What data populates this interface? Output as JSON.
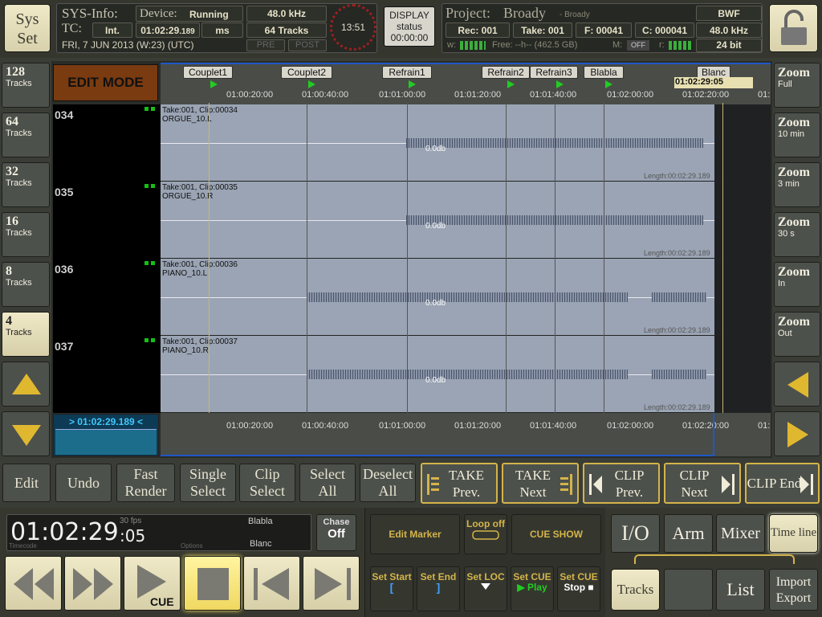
{
  "header": {
    "sys_set": "Sys Set",
    "sysinfo_label": "SYS-Info:",
    "device_label": "Device:",
    "device_status": "Running",
    "sample_rate": "48.0 kHz",
    "tc_label": "TC:",
    "tc_mode": "Int.",
    "tc_value": "01:02:29",
    "tc_frames": ".189",
    "tc_unit": "ms",
    "tracks_count": "64 Tracks",
    "date": "FRI, 7 JUN 2013 (W:23) (UTC)",
    "pre": "PRE",
    "post": "POST",
    "clock": "13:51",
    "display_label": "DISPLAY",
    "display_status": "status",
    "display_time": "00:00:00",
    "project_label": "Project:",
    "project_name": "Broady",
    "project_sub": "- Broady",
    "format": "BWF",
    "rec": "Rec: 001",
    "take": "Take: 001",
    "f": "F: 00041",
    "c": "C: 000041",
    "proj_rate": "48.0 kHz",
    "bit_depth": "24 bit",
    "w_label": "w:",
    "free": "Free: --h-- (462.5 GB)",
    "m_label": "M:",
    "m_value": "OFF",
    "r_label": "r:"
  },
  "left_buttons": [
    {
      "big": "128",
      "small": "Tracks"
    },
    {
      "big": "64",
      "small": "Tracks"
    },
    {
      "big": "32",
      "small": "Tracks"
    },
    {
      "big": "16",
      "small": "Tracks"
    },
    {
      "big": "8",
      "small": "Tracks"
    },
    {
      "big": "4",
      "small": "Tracks"
    }
  ],
  "right_buttons": [
    {
      "big": "Zoom",
      "small": "Full"
    },
    {
      "big": "Zoom",
      "small": "10 min"
    },
    {
      "big": "Zoom",
      "small": "3 min"
    },
    {
      "big": "Zoom",
      "small": "30 s"
    },
    {
      "big": "Zoom",
      "small": "In"
    },
    {
      "big": "Zoom",
      "small": "Out"
    }
  ],
  "edit_mode": "EDIT MODE",
  "markers": [
    "Couplet1",
    "Couplet2",
    "Refrain1",
    "Refrain2",
    "Refrain3",
    "Blabla",
    "Blanc"
  ],
  "cursor_time": "01:02:29:05",
  "ruler_ticks": [
    "01:00:20:00",
    "01:00:40:00",
    "01:01:00:00",
    "01:01:20:00",
    "01:01:40:00",
    "01:02:00:00",
    "01:02:20:00",
    "01:"
  ],
  "tracks": [
    {
      "num": "034",
      "clip": "Take:001, Clip:00034",
      "name": "ORGUE_10.L",
      "db": "0.0db",
      "length": "Length:00:02:29.189"
    },
    {
      "num": "035",
      "clip": "Take:001, Clip:00035",
      "name": "ORGUE_10.R",
      "db": "0.0db",
      "length": "Length:00:02:29.189"
    },
    {
      "num": "036",
      "clip": "Take:001, Clip:00036",
      "name": "PIANO_10.L",
      "db": "0.0db",
      "length": "Length:00:02:29.189"
    },
    {
      "num": "037",
      "clip": "Take:001, Clip:00037",
      "name": "PIANO_10.R",
      "db": "0.0db",
      "length": "Length:00:02:29.189"
    }
  ],
  "bottom_ruler_ticks": [
    "01:00:20:00",
    "01:00:40:00",
    "01:01:00:00",
    "01:01:20:00",
    "01:01:40:00",
    "01:02:00:00",
    "01:02:20:00",
    "01:"
  ],
  "bottom_tc": "> 01:02:29.189 <",
  "toolbar": {
    "edit": "Edit",
    "undo": "Undo",
    "fast_render": "Fast Render",
    "single_select": "Single Select",
    "clip_select": "Clip Select",
    "select_all": "Select All",
    "deselect_all": "Deselect All",
    "take_prev": "TAKE Prev.",
    "take_next": "TAKE Next",
    "clip_prev": "CLIP Prev.",
    "clip_next": "CLIP Next",
    "clip_end": "CLIP End"
  },
  "transport": {
    "timecode": "01:02:29",
    "frames": ":05",
    "fps": "30 fps",
    "marker_prev": "Blabla",
    "marker_next": "Blanc",
    "timecode_label": "Timecode",
    "options_label": "Options",
    "chase_label": "Chase",
    "chase_value": "Off",
    "cue_label": "CUE"
  },
  "mid_controls": {
    "edit_marker": "Edit Marker",
    "loop": "Loop off",
    "cue_show": "CUE SHOW",
    "set_start": "Set Start",
    "set_end": "Set End",
    "set_loc": "Set LOC",
    "set_cue_play": "Set CUE",
    "play_label": "Play",
    "set_cue_stop": "Set CUE",
    "stop_label": "Stop"
  },
  "right_controls": {
    "io": "I/O",
    "arm": "Arm",
    "mixer": "Mixer",
    "timeline": "Time line",
    "tracks": "Tracks",
    "list": "List",
    "import_export": "Import Export"
  },
  "colors": {
    "accent_gold": "#d4b44a",
    "beige": "#e8e2c0",
    "lane": "#9aa4b4",
    "edit_mode": "#7a3b10",
    "marker_green": "#22cc22"
  }
}
